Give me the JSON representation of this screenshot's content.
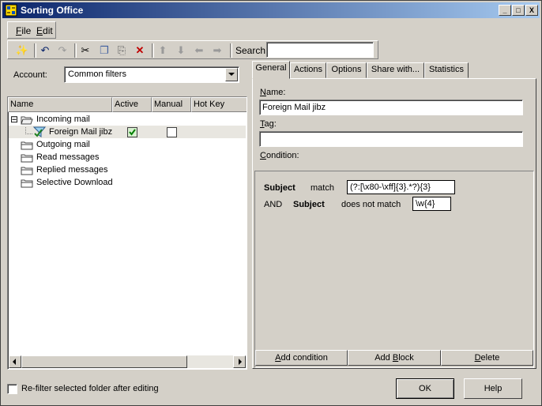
{
  "window": {
    "title": "Sorting Office",
    "controls": [
      "_",
      "□",
      "X"
    ]
  },
  "menu": {
    "file": {
      "u": "F",
      "rest": "ile"
    },
    "edit": {
      "u": "E",
      "rest": "dit"
    }
  },
  "toolbar": {
    "search_label": "Search",
    "search_value": "",
    "icons": {
      "new": "✨",
      "undo": "↶",
      "redo": "↷",
      "cut": "✂",
      "copy": "❐",
      "paste": "⎘",
      "delete": "✕",
      "up": "⬆",
      "down": "⬇",
      "left": "⬅",
      "right": "➡"
    }
  },
  "account": {
    "label": "Account:",
    "value": "Common filters"
  },
  "tree": {
    "columns": [
      "Name",
      "Active",
      "Manual",
      "Hot Key"
    ],
    "expander": "⊟",
    "incoming": "Incoming mail",
    "filter": {
      "name": "Foreign Mail jibz",
      "active": true,
      "manual": false
    },
    "folders": [
      "Outgoing mail",
      "Read messages",
      "Replied messages",
      "Selective Download"
    ]
  },
  "tabs": [
    "General",
    "Actions",
    "Options",
    "Share with...",
    "Statistics"
  ],
  "general": {
    "name_label": {
      "u": "N",
      "rest": "ame:"
    },
    "name_value": "Foreign Mail jibz",
    "tag_label": {
      "u": "T",
      "rest": "ag:"
    },
    "tag_value": "",
    "condition_label": {
      "u": "C",
      "rest": "ondition:"
    }
  },
  "conditions": {
    "row1": {
      "field": "Subject",
      "op": "match",
      "value": "(?:[\\x80-\\xff]{3}.*?){3}"
    },
    "row2": {
      "join": "AND",
      "field": "Subject",
      "op": "does not match",
      "value": "\\w{4}"
    }
  },
  "condition_buttons": {
    "add_condition": {
      "pre": "",
      "u": "A",
      "rest": "dd condition"
    },
    "add_block": {
      "pre": "Add ",
      "u": "B",
      "rest": "lock"
    },
    "delete": {
      "pre": "",
      "u": "D",
      "rest": "elete"
    }
  },
  "footer": {
    "refilter_label": "Re-filter selected folder after editing",
    "ok": "OK",
    "help": "Help"
  },
  "colors": {
    "face": "#d4d0c8",
    "title_start": "#0a246a",
    "title_end": "#a6caf0",
    "selection": "#e8e6e0"
  }
}
